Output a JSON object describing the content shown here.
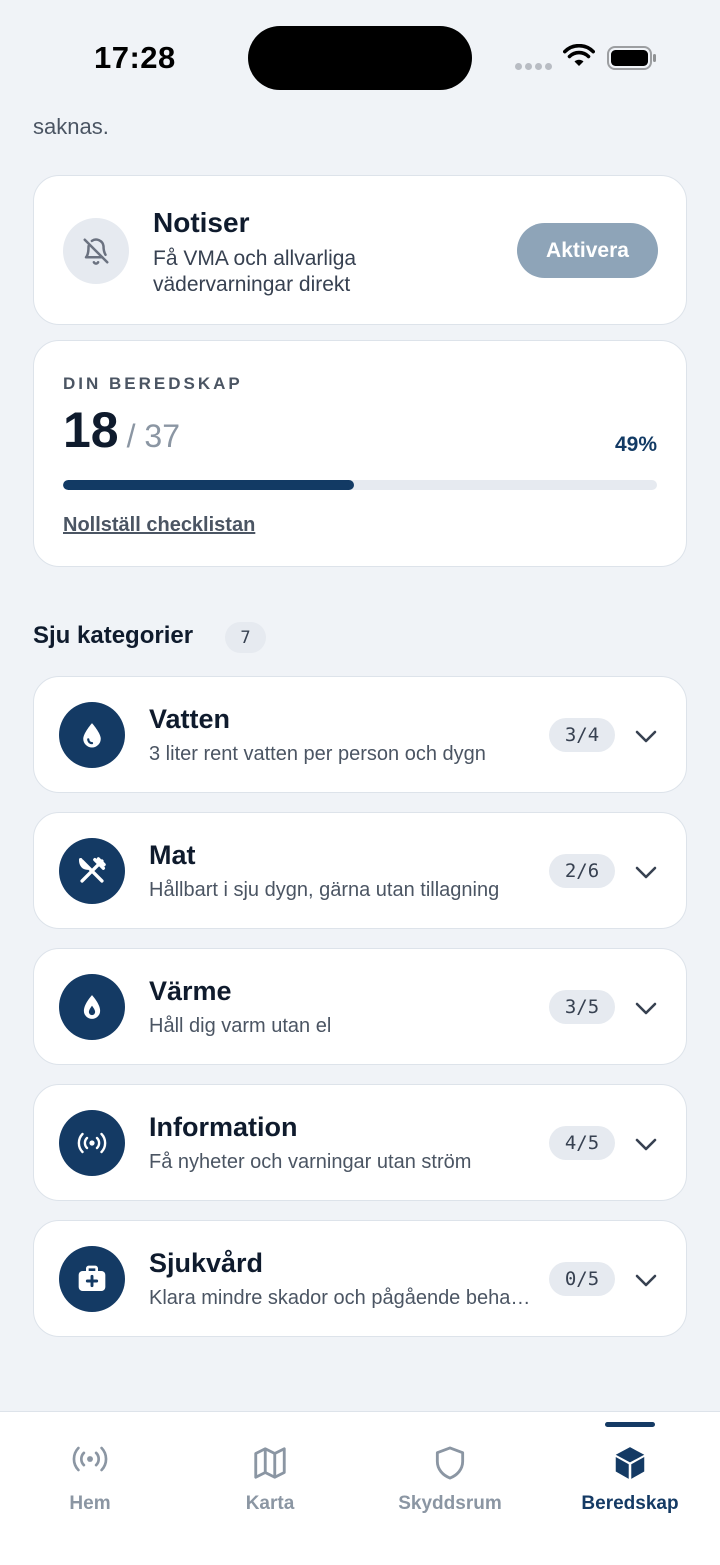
{
  "status_bar": {
    "time": "17:28"
  },
  "top_text": "saknas.",
  "notifications_card": {
    "title": "Notiser",
    "description": "Få VMA och allvarliga vädervarningar direkt",
    "button_label": "Aktivera"
  },
  "preparedness": {
    "label": "DIN BEREDSKAP",
    "done": "18",
    "total": "/ 37",
    "percent_label": "49%",
    "progress_fraction": 0.49,
    "reset_link": "Nollställ checklistan"
  },
  "categories_section": {
    "title": "Sju kategorier",
    "count": "7"
  },
  "categories": [
    {
      "name": "Vatten",
      "description": "3 liter rent vatten per person och dygn",
      "progress": "3/4",
      "icon": "water-drop-icon"
    },
    {
      "name": "Mat",
      "description": "Hållbart i sju dygn, gärna utan tillagning",
      "progress": "2/6",
      "icon": "fork-knife-icon"
    },
    {
      "name": "Värme",
      "description": "Håll dig varm utan el",
      "progress": "3/5",
      "icon": "flame-icon"
    },
    {
      "name": "Information",
      "description": "Få nyheter och varningar utan ström",
      "progress": "4/5",
      "icon": "broadcast-icon"
    },
    {
      "name": "Sjukvård",
      "description": "Klara mindre skador och pågående behandling",
      "progress": "0/5",
      "icon": "first-aid-kit-icon"
    }
  ],
  "tabbar": {
    "items": [
      {
        "label": "Hem",
        "icon": "broadcast-icon",
        "active": false
      },
      {
        "label": "Karta",
        "icon": "map-icon",
        "active": false
      },
      {
        "label": "Skyddsrum",
        "icon": "shield-icon",
        "active": false
      },
      {
        "label": "Beredskap",
        "icon": "cube-icon",
        "active": true
      }
    ]
  },
  "colors": {
    "accent": "#143a64",
    "background": "#f0f3f7",
    "button_disabled": "#8ea4b8"
  }
}
